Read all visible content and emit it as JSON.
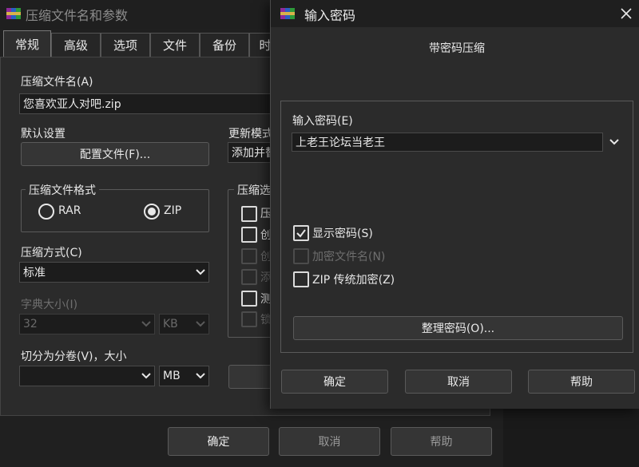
{
  "back_window": {
    "title": "压缩文件名和参数",
    "tabs": [
      "常规",
      "高级",
      "选项",
      "文件",
      "备份",
      "时"
    ],
    "archive_name_label": "压缩文件名(A)",
    "archive_name_value": "您喜欢亚人对吧.zip",
    "default_settings_label": "默认设置",
    "profiles_button": "配置文件(F)...",
    "update_mode_label": "更新模式",
    "update_mode_value": "添加并替",
    "format_group_label": "压缩文件格式",
    "format_options": [
      {
        "label": "RAR",
        "selected": false
      },
      {
        "label": "ZIP",
        "selected": true
      }
    ],
    "options_group_label": "压缩选",
    "option_fragments": [
      "压",
      "创",
      "创",
      "添",
      "测",
      "锁"
    ],
    "method_label": "压缩方式(C)",
    "method_value": "标准",
    "dict_size_label": "字典大小(I)",
    "dict_size_value": "32",
    "dict_unit_value": "KB",
    "split_label": "切分为分卷(V)，大小",
    "split_value": "",
    "split_unit_value": "MB",
    "ok_button": "确定",
    "cancel_button": "取消",
    "help_button": "帮助"
  },
  "password_dialog": {
    "title": "输入密码",
    "subtitle": "带密码压缩",
    "password_label": "输入密码(E)",
    "password_value": "上老王论坛当老王",
    "options": [
      {
        "label": "显示密码(S)",
        "checked": true,
        "enabled": true
      },
      {
        "label": "加密文件名(N)",
        "checked": false,
        "enabled": false
      },
      {
        "label": "ZIP 传统加密(Z)",
        "checked": false,
        "enabled": true
      }
    ],
    "organize_button": "整理密码(O)...",
    "ok_button": "确定",
    "cancel_button": "取消",
    "help_button": "帮助"
  }
}
